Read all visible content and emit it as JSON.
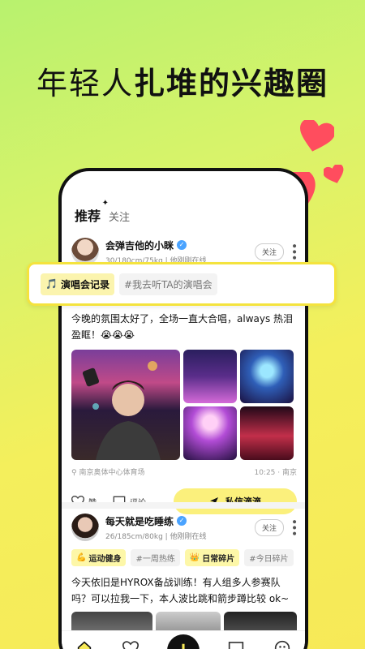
{
  "headline": {
    "normal": "年轻人",
    "bold": "扎堆的兴趣圈"
  },
  "tabs": {
    "active": "推荐",
    "other": "关注"
  },
  "overlay_tags": {
    "primary": "演唱会记录",
    "secondary": "#我去听TA的演唱会"
  },
  "post1": {
    "author": "会弹吉他的小眯",
    "meta": "30/180cm/75kg | 他刚刚在线",
    "follow": "关注",
    "text": "今晚的氛围太好了，全场一直大合唱，always 热泪盈眶！😭😭😭",
    "location": "南京奥体中心体育场",
    "time_place": "10:25 · 南京",
    "like": "赞",
    "comment": "评论",
    "dm": "私信滴滴"
  },
  "post2": {
    "author": "每天就是吃睡练",
    "meta": "26/185cm/80kg | 他刚刚在线",
    "follow": "关注",
    "tags": [
      {
        "label": "运动健身",
        "style": "yellow"
      },
      {
        "label": "#一周热练",
        "style": "gray"
      },
      {
        "label": "日常碎片",
        "style": "yellow"
      },
      {
        "label": "#今日碎片",
        "style": "gray"
      }
    ],
    "text": "今天依旧是HYROX备战训练！有人组多人参赛队吗？可以拉我一下，本人波比跳和箭步蹲比较 ok~"
  },
  "colors": {
    "accent": "#f4e33e",
    "heart": "#ff4d5e",
    "bg_start": "#b8f26e",
    "bg_end": "#f7e957"
  }
}
